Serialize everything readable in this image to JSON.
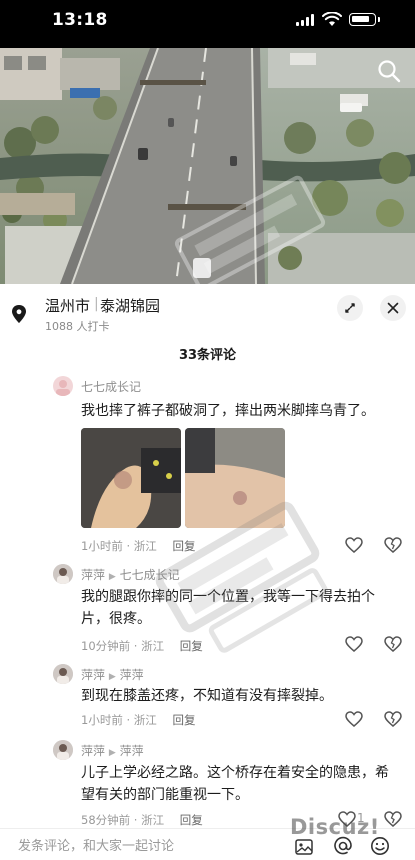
{
  "status_bar": {
    "time": "13:18"
  },
  "location": {
    "city": "温州市",
    "separator": "|",
    "place": "泰湖锦园",
    "checkins": "1088 人打卡"
  },
  "comments_header": {
    "count_label": "33条评论"
  },
  "comments": [
    {
      "username": "七七成长记",
      "text": "我也摔了裤子都破洞了，摔出两米脚摔乌青了。",
      "time": "1小时前",
      "region": "浙江",
      "reply_label": "回复",
      "likes": "",
      "has_photos": true
    },
    {
      "username": "萍萍",
      "reply_to": "七七成长记",
      "text": "我的腿跟你摔的同一个位置，我等一下得去拍个片，很疼。",
      "time": "10分钟前",
      "region": "浙江",
      "reply_label": "回复",
      "likes": ""
    },
    {
      "username": "萍萍",
      "reply_to": "萍萍",
      "text": "到现在膝盖还疼，不知道有没有摔裂掉。",
      "time": "1小时前",
      "region": "浙江",
      "reply_label": "回复",
      "likes": ""
    },
    {
      "username": "萍萍",
      "reply_to": "萍萍",
      "text": "儿子上学必经之路。这个桥存在着安全的隐患，希望有关的部门能重视一下。",
      "time": "58分钟前",
      "region": "浙江",
      "reply_label": "回复",
      "likes": "1"
    }
  ],
  "input": {
    "placeholder": "发条评论，和大家一起讨论"
  },
  "watermark": {
    "text": "Discuz!"
  },
  "icons": {
    "search": "search-icon",
    "location": "pin-icon",
    "expand": "expand-icon",
    "close": "close-icon",
    "like": "heart-icon",
    "dislike": "broken-heart-icon",
    "image": "image-icon",
    "mention": "at-icon",
    "emoji": "emoji-icon"
  }
}
